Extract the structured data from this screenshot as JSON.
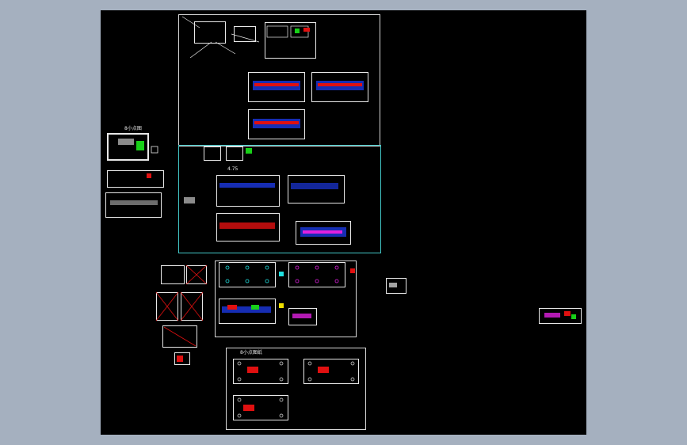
{
  "colors": {
    "window_bg": "#a5b0bf",
    "drawing_bg": "#000000",
    "frame_white": "#d8d8d8",
    "frame_cyan": "#43c8c8",
    "red": "#e01010",
    "green": "#18d018",
    "blue": "#2040ff",
    "magenta": "#e020e0",
    "yellow": "#f0e000",
    "cyan": "#20e0e0"
  },
  "labels": {
    "mini_text_left": "8小点图",
    "mini_text_bottom": "8小点图纸",
    "mini_text_center": "4.75"
  }
}
